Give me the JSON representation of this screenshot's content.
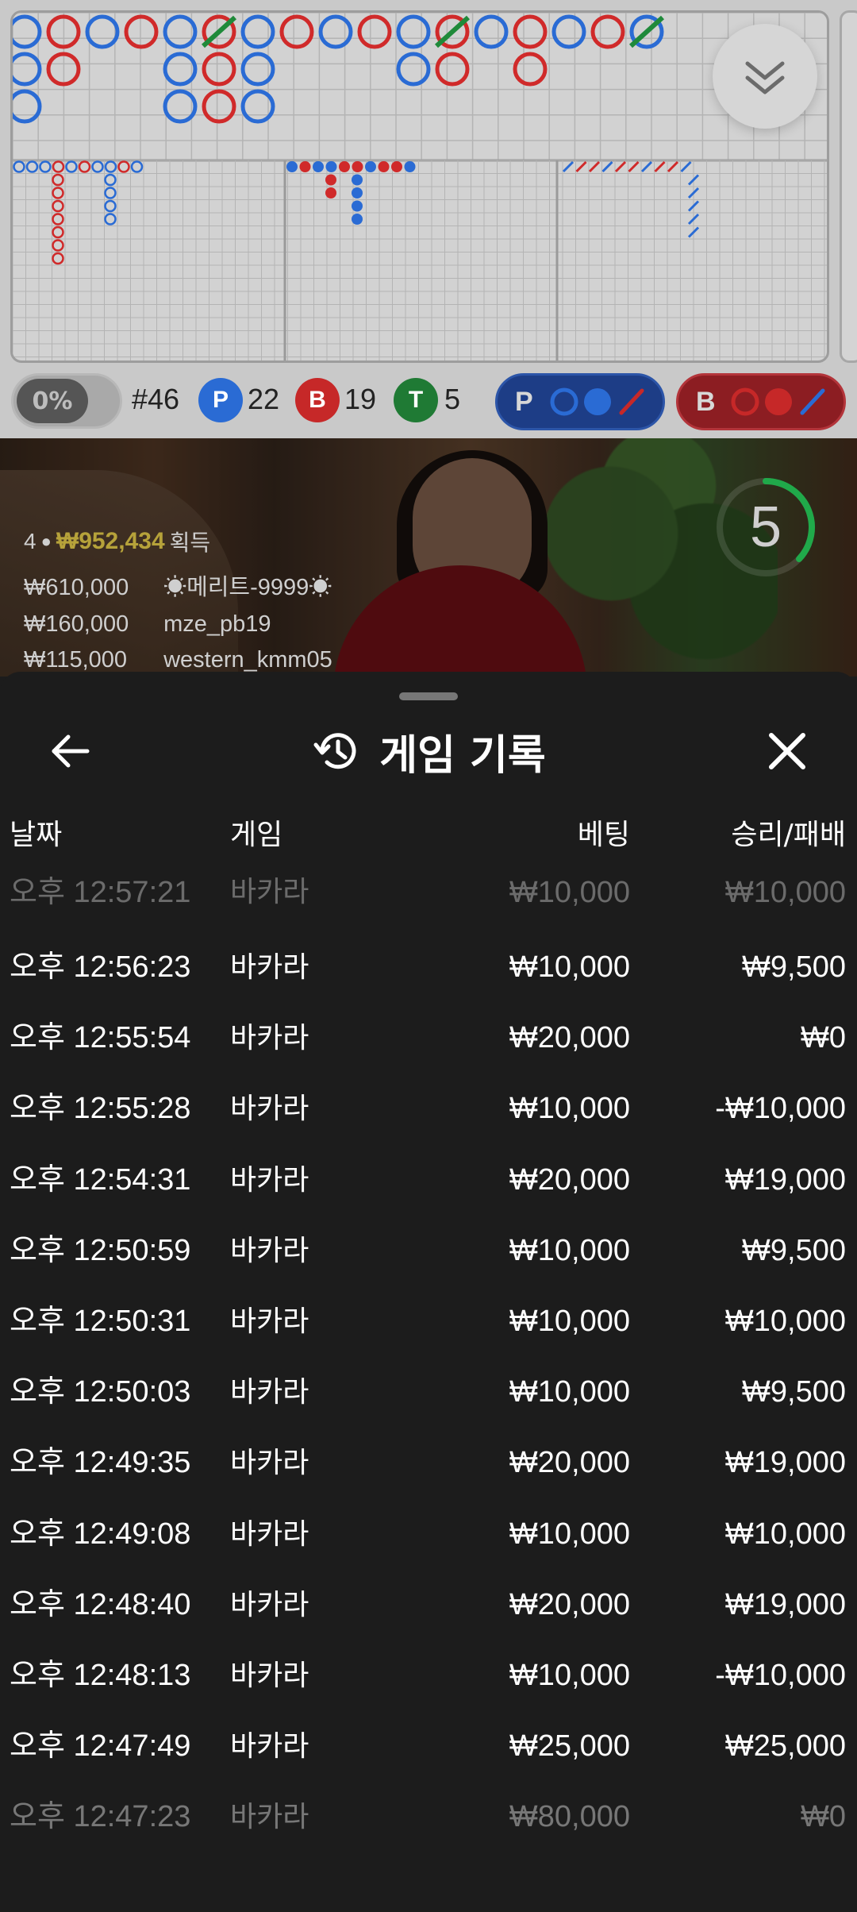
{
  "stats": {
    "percent": "0%",
    "round": "#46",
    "player_label": "P",
    "player_count": "22",
    "banker_label": "B",
    "banker_count": "19",
    "tie_label": "T",
    "tie_count": "5",
    "player_predict_label": "P",
    "banker_predict_label": "B"
  },
  "colors": {
    "player": "#2a6bd4",
    "banker": "#d02a2a",
    "tie": "#2e8b3a",
    "sheet_bg": "#1c1c1c"
  },
  "video": {
    "countdown": "5",
    "winner_count": "4",
    "winner_total": "₩952,434",
    "winner_suffix": "획득",
    "winners": [
      {
        "amount": "₩610,000",
        "name": "☀메리트-9999☀"
      },
      {
        "amount": "₩160,000",
        "name": "mze_pb19"
      },
      {
        "amount": "₩115,000",
        "name": "western_kmm05"
      }
    ]
  },
  "sheet": {
    "title": "게임 기록",
    "columns": {
      "date": "날짜",
      "game": "게임",
      "bet": "베팅",
      "result": "승리/패배"
    },
    "rows": [
      {
        "time": "오후 12:57:21",
        "game": "바카라",
        "bet": "₩10,000",
        "result": "₩10,000"
      },
      {
        "time": "오후 12:56:23",
        "game": "바카라",
        "bet": "₩10,000",
        "result": "₩9,500"
      },
      {
        "time": "오후 12:55:54",
        "game": "바카라",
        "bet": "₩20,000",
        "result": "₩0"
      },
      {
        "time": "오후 12:55:28",
        "game": "바카라",
        "bet": "₩10,000",
        "result": "-₩10,000"
      },
      {
        "time": "오후 12:54:31",
        "game": "바카라",
        "bet": "₩20,000",
        "result": "₩19,000"
      },
      {
        "time": "오후 12:50:59",
        "game": "바카라",
        "bet": "₩10,000",
        "result": "₩9,500"
      },
      {
        "time": "오후 12:50:31",
        "game": "바카라",
        "bet": "₩10,000",
        "result": "₩10,000"
      },
      {
        "time": "오후 12:50:03",
        "game": "바카라",
        "bet": "₩10,000",
        "result": "₩9,500"
      },
      {
        "time": "오후 12:49:35",
        "game": "바카라",
        "bet": "₩20,000",
        "result": "₩19,000"
      },
      {
        "time": "오후 12:49:08",
        "game": "바카라",
        "bet": "₩10,000",
        "result": "₩10,000"
      },
      {
        "time": "오후 12:48:40",
        "game": "바카라",
        "bet": "₩20,000",
        "result": "₩19,000"
      },
      {
        "time": "오후 12:48:13",
        "game": "바카라",
        "bet": "₩10,000",
        "result": "-₩10,000"
      },
      {
        "time": "오후 12:47:49",
        "game": "바카라",
        "bet": "₩25,000",
        "result": "₩25,000"
      },
      {
        "time": "오후 12:47:23",
        "game": "바카라",
        "bet": "₩80,000",
        "result": "₩0"
      }
    ]
  }
}
